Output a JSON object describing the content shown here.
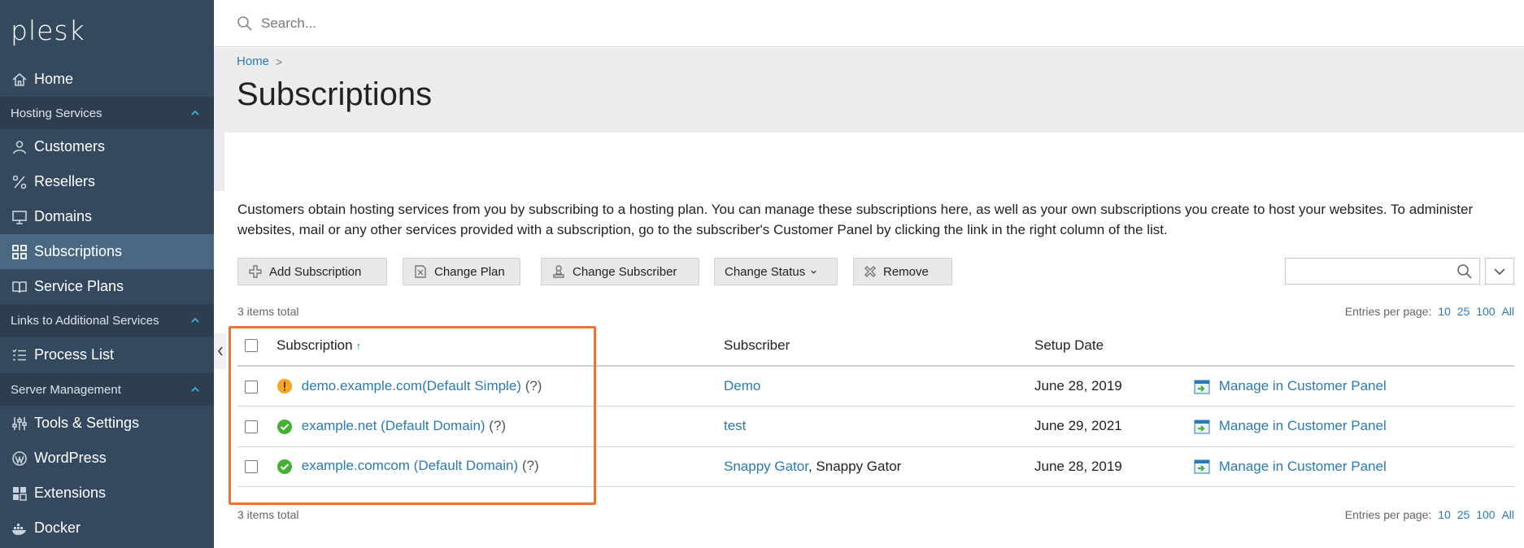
{
  "logo": "plesk",
  "sidebar": {
    "items_top": [
      {
        "label": "Home",
        "icon": "home-icon"
      }
    ],
    "section_hosting": "Hosting Services",
    "hosting_items": [
      {
        "label": "Customers",
        "icon": "user-icon"
      },
      {
        "label": "Resellers",
        "icon": "percent-icon"
      },
      {
        "label": "Domains",
        "icon": "monitor-icon"
      },
      {
        "label": "Subscriptions",
        "icon": "grid-icon",
        "active": true
      },
      {
        "label": "Service Plans",
        "icon": "book-icon"
      }
    ],
    "section_links": "Links to Additional Services",
    "links_items": [
      {
        "label": "Process List",
        "icon": "list-icon"
      }
    ],
    "section_server": "Server Management",
    "server_items": [
      {
        "label": "Tools & Settings",
        "icon": "tools-icon"
      },
      {
        "label": "WordPress",
        "icon": "wordpress-icon"
      },
      {
        "label": "Extensions",
        "icon": "extensions-icon"
      },
      {
        "label": "Docker",
        "icon": "docker-icon"
      }
    ]
  },
  "topbar": {
    "search_placeholder": "Search..."
  },
  "breadcrumb": {
    "home": "Home",
    "sep": ">"
  },
  "page_title": "Subscriptions",
  "description": "Customers obtain hosting services from you by subscribing to a hosting plan. You can manage these subscriptions here, as well as your own subscriptions you create to host your websites. To administer websites, mail or any other services provided with a subscription, go to the subscriber's Customer Panel by clicking the link in the right column of the list.",
  "toolbar": {
    "add": "Add Subscription",
    "change_plan": "Change Plan",
    "change_subscriber": "Change Subscriber",
    "change_status": "Change Status",
    "remove": "Remove"
  },
  "list": {
    "total_top": "3 items total",
    "total_bottom": "3 items total",
    "entries_label": "Entries per page:",
    "entries_options": [
      "10",
      "25",
      "100",
      "All"
    ],
    "columns": {
      "subscription": "Subscription",
      "sort": "↑",
      "subscriber": "Subscriber",
      "setup_date": "Setup Date"
    },
    "rows": [
      {
        "status": "warning",
        "subscription": "demo.example.com(Default Simple)",
        "help": "(?)",
        "subscriber": "Demo",
        "subscriber_extra": "",
        "date": "June 28, 2019",
        "manage": "Manage in Customer Panel"
      },
      {
        "status": "ok",
        "subscription": "example.net (Default Domain)",
        "help": "(?)",
        "subscriber": "test",
        "subscriber_extra": "",
        "date": "June 29, 2021",
        "manage": "Manage in Customer Panel"
      },
      {
        "status": "ok",
        "subscription": "example.comcom (Default Domain)",
        "help": "(?)",
        "subscriber": "Snappy Gator",
        "subscriber_extra": ", Snappy Gator",
        "date": "June 28, 2019",
        "manage": "Manage in Customer Panel"
      }
    ]
  },
  "colors": {
    "sidebar": "#34495e",
    "sidebar_section": "#2c3e50",
    "active": "#4b6882",
    "link": "#2a7bb4",
    "highlight": "#ee7433",
    "ok": "#44b034",
    "warning": "#f5a623"
  }
}
